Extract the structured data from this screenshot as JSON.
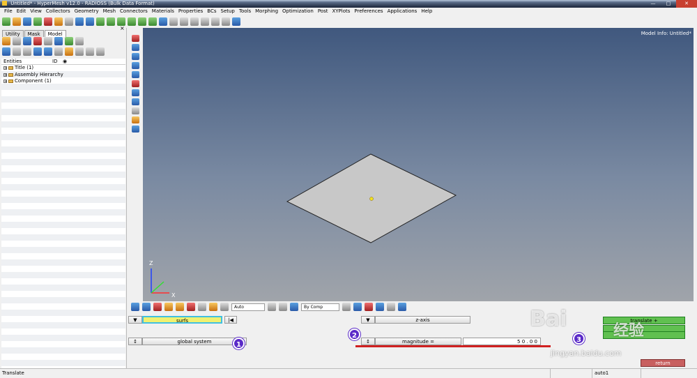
{
  "title": "Untitled* - HyperMesh v12.0 - RADIOSS (Bulk Data Format)",
  "menu": [
    "File",
    "Edit",
    "View",
    "Collectors",
    "Geometry",
    "Mesh",
    "Connectors",
    "Materials",
    "Properties",
    "BCs",
    "Setup",
    "Tools",
    "Morphing",
    "Optimization",
    "Post",
    "XYPlots",
    "Preferences",
    "Applications",
    "Help"
  ],
  "left_tabs": [
    "Utility",
    "Mask",
    "Model"
  ],
  "entities_header": {
    "col1": "Entities",
    "col2": "ID"
  },
  "entities": [
    "Title (1)",
    "Assembly Hierarchy",
    "Component (1)"
  ],
  "model_info": "Model Info: Untitled*",
  "axis_labels": {
    "z": "Z",
    "x": "X"
  },
  "bottom_toolbar": {
    "auto": "Auto",
    "bycomp": "By Comp"
  },
  "panel": {
    "surfs": "surfs",
    "global_system": "global system",
    "z_axis": "z-axis",
    "magnitude": "magnitude =",
    "magnitude_value": "5 0 . 0 0",
    "translate_plus": "translate +",
    "return": "return"
  },
  "status": {
    "left": "Translate",
    "right": "auto1"
  },
  "badges": [
    "1",
    "2",
    "3"
  ],
  "watermark": {
    "main": "Bai",
    "sub": "经验",
    "url": "jingyan.baidu.com"
  }
}
